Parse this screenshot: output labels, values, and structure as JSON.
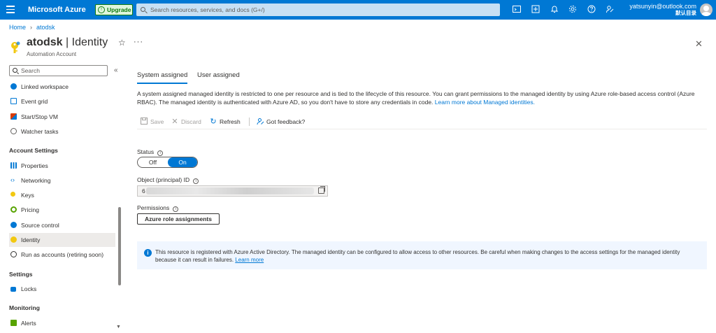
{
  "topbar": {
    "brand": "Microsoft Azure",
    "upgrade_label": "Upgrade",
    "search_placeholder": "Search resources, services, and docs (G+/)",
    "account_email": "yatsunyin@outlook.com",
    "account_directory": "默认目录"
  },
  "breadcrumb": {
    "home": "Home",
    "resource": "atodsk"
  },
  "header": {
    "resource_name": "atodsk",
    "separator": "|",
    "page_name": "Identity",
    "resource_type": "Automation Account"
  },
  "sidebar": {
    "search_placeholder": "Search",
    "items_top": [
      {
        "label": "Linked workspace",
        "icon": "linked-workspace-icon",
        "color": "#0078d4"
      },
      {
        "label": "Event grid",
        "icon": "event-grid-icon",
        "color": "#0078d4"
      },
      {
        "label": "Start/Stop VM",
        "icon": "start-stop-vm-icon",
        "color": "#d83b01"
      },
      {
        "label": "Watcher tasks",
        "icon": "watcher-tasks-icon",
        "color": "#605e5c"
      }
    ],
    "section_account_settings": "Account Settings",
    "items_account": [
      {
        "label": "Properties",
        "icon": "properties-icon",
        "color": "#0078d4"
      },
      {
        "label": "Networking",
        "icon": "networking-icon",
        "color": "#0078d4"
      },
      {
        "label": "Keys",
        "icon": "key-icon",
        "color": "#f2c811"
      },
      {
        "label": "Pricing",
        "icon": "pricing-icon",
        "color": "#57a300"
      },
      {
        "label": "Source control",
        "icon": "source-control-icon",
        "color": "#0078d4"
      },
      {
        "label": "Identity",
        "icon": "identity-icon",
        "color": "#f2c811"
      },
      {
        "label": "Run as accounts (retiring soon)",
        "icon": "run-as-accounts-icon",
        "color": "#323130"
      }
    ],
    "section_settings": "Settings",
    "items_settings": [
      {
        "label": "Locks",
        "icon": "lock-icon",
        "color": "#0078d4"
      }
    ],
    "section_monitoring": "Monitoring",
    "items_monitoring": [
      {
        "label": "Alerts",
        "icon": "alerts-icon",
        "color": "#57a300"
      }
    ]
  },
  "tabs": [
    {
      "label": "System assigned",
      "active": true
    },
    {
      "label": "User assigned",
      "active": false
    }
  ],
  "description": {
    "text": "A system assigned managed identity is restricted to one per resource and is tied to the lifecycle of this resource. You can grant permissions to the managed identity by using Azure role-based access control (Azure RBAC). The managed identity is authenticated with Azure AD, so you don't have to store any credentials in code.",
    "link": "Learn more about Managed identities."
  },
  "commands": {
    "save": "Save",
    "discard": "Discard",
    "refresh": "Refresh",
    "feedback": "Got feedback?"
  },
  "status": {
    "label": "Status",
    "off_label": "Off",
    "on_label": "On",
    "value": "On"
  },
  "object_id": {
    "label": "Object (principal) ID",
    "value": "6"
  },
  "permissions": {
    "label": "Permissions",
    "button": "Azure role assignments"
  },
  "info_banner": {
    "text": "This resource is registered with Azure Active Directory. The managed identity can be configured to allow access to other resources. Be careful when making changes to the access settings for the managed identity because it can result in failures.",
    "link": "Learn more"
  },
  "colors": {
    "azure_blue": "#0078d4",
    "selected_bg": "#edebe9",
    "info_bg": "#f0f6ff"
  }
}
